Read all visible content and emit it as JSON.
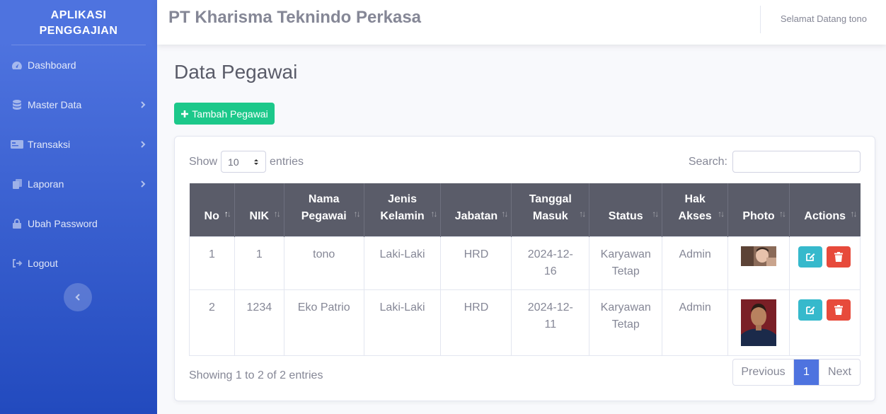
{
  "sidebar": {
    "brand_line1": "APLIKASI",
    "brand_line2": "PENGGAJIAN",
    "items": [
      {
        "label": "Dashboard",
        "icon": "dashboard-icon",
        "has_chevron": false
      },
      {
        "label": "Master Data",
        "icon": "database-icon",
        "has_chevron": true
      },
      {
        "label": "Transaksi",
        "icon": "card-icon",
        "has_chevron": true
      },
      {
        "label": "Laporan",
        "icon": "copy-icon",
        "has_chevron": true
      },
      {
        "label": "Ubah Password",
        "icon": "lock-icon",
        "has_chevron": false
      },
      {
        "label": "Logout",
        "icon": "sign-out-icon",
        "has_chevron": false
      }
    ]
  },
  "topbar": {
    "company": "PT Kharisma Teknindo Perkasa",
    "welcome": "Selamat Datang tono"
  },
  "page": {
    "title": "Data Pegawai",
    "add_button": "Tambah Pegawai"
  },
  "table_controls": {
    "show_label": "Show",
    "entries_value": "10",
    "entries_label": "entries",
    "search_label": "Search:"
  },
  "table": {
    "headers": [
      {
        "line1": "No",
        "line2": ""
      },
      {
        "line1": "NIK",
        "line2": ""
      },
      {
        "line1": "Nama",
        "line2": "Pegawai"
      },
      {
        "line1": "Jenis",
        "line2": "Kelamin"
      },
      {
        "line1": "Jabatan",
        "line2": ""
      },
      {
        "line1": "Tanggal",
        "line2": "Masuk"
      },
      {
        "line1": "Status",
        "line2": ""
      },
      {
        "line1": "Hak",
        "line2": "Akses"
      },
      {
        "line1": "Photo",
        "line2": ""
      },
      {
        "line1": "Actions",
        "line2": ""
      }
    ],
    "rows": [
      {
        "no": "1",
        "nik": "1",
        "nama": "tono",
        "jk": "Laki-Laki",
        "jabatan": "HRD",
        "tanggal": "2024-12-16",
        "status": "Karyawan Tetap",
        "akses": "Admin"
      },
      {
        "no": "2",
        "nik": "1234",
        "nama": "Eko Patrio",
        "jk": "Laki-Laki",
        "jabatan": "HRD",
        "tanggal": "2024-12-11",
        "status": "Karyawan Tetap",
        "akses": "Admin"
      }
    ]
  },
  "footer": {
    "info": "Showing 1 to 2 of 2 entries",
    "prev": "Previous",
    "page": "1",
    "next": "Next"
  },
  "colors": {
    "sidebar": "#4e73df",
    "success": "#1cc88a",
    "info": "#36b9cc",
    "danger": "#e74a3b",
    "header": "#5a5c69"
  }
}
